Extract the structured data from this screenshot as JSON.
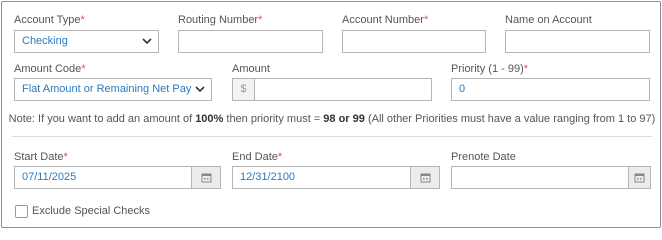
{
  "row1": {
    "account_type": {
      "label": "Account Type",
      "required": "*",
      "value": "Checking"
    },
    "routing_number": {
      "label": "Routing Number",
      "required": "*",
      "value": ""
    },
    "account_number": {
      "label": "Account Number",
      "required": "*",
      "value": ""
    },
    "name_on_account": {
      "label": "Name on Account",
      "value": ""
    }
  },
  "row2": {
    "amount_code": {
      "label": "Amount Code",
      "required": "*",
      "value": "Flat Amount or Remaining Net Pay"
    },
    "amount": {
      "label": "Amount",
      "prefix": "$",
      "value": ""
    },
    "priority": {
      "label": "Priority (1 - 99)",
      "required": "*",
      "value": "0"
    }
  },
  "note": {
    "part1": "Note: If you want to add an amount of ",
    "bold1": "100%",
    "part2": " then priority must = ",
    "bold2": "98 or 99",
    "part3": " (All other Priorities must have a value ranging from 1 to 97)"
  },
  "row3": {
    "start_date": {
      "label": "Start Date",
      "required": "*",
      "value": "07/11/2025"
    },
    "end_date": {
      "label": "End Date",
      "required": "*",
      "value": "12/31/2100"
    },
    "prenote_date": {
      "label": "Prenote Date",
      "value": ""
    }
  },
  "exclude_special_checks": {
    "label": "Exclude Special Checks",
    "checked": false
  },
  "icons": {
    "select": "chevron-down-icon",
    "date": "calendar-icon"
  },
  "colors": {
    "required": "#d9534f",
    "value_text": "#2a7bc0",
    "border": "#b5b5b5"
  }
}
